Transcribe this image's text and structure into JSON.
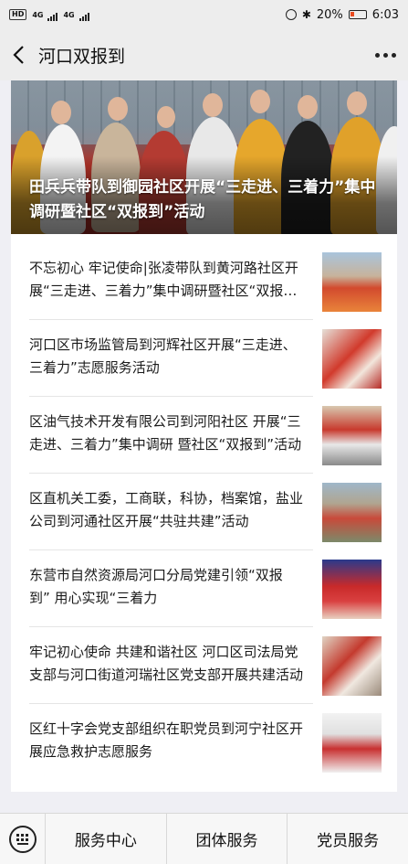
{
  "status_bar": {
    "hd": "HD",
    "net1": "4G",
    "net2": "4G",
    "battery_percent": "20%",
    "time": "6:03"
  },
  "header": {
    "title": "河口双报到"
  },
  "hero": {
    "title": "田兵兵带队到御园社区开展“三走进、三着力”集中调研暨社区“双报到”活动"
  },
  "articles": [
    {
      "title": "不忘初心 牢记使命|张凌带队到黄河路社区开展“三走进、三着力”集中调研暨社区“双报到”活动"
    },
    {
      "title": "河口区市场监管局到河辉社区开展“三走进、三着力”志愿服务活动"
    },
    {
      "title": "区油气技术开发有限公司到河阳社区 开展“三走进、三着力”集中调研 暨社区“双报到”活动"
    },
    {
      "title": "区直机关工委，工商联，科协，档案馆，盐业公司到河通社区开展“共驻共建”活动"
    },
    {
      "title": "东营市自然资源局河口分局党建引领“双报到” 用心实现“三着力"
    },
    {
      "title": "牢记初心使命 共建和谐社区 河口区司法局党支部与河口街道河瑞社区党支部开展共建活动"
    },
    {
      "title": "区红十字会党支部组织在职党员到河宁社区开展应急救护志愿服务"
    }
  ],
  "bottom_menu": {
    "items": [
      "服务中心",
      "团体服务",
      "党员服务"
    ]
  },
  "colors": {
    "accent_red": "#c8281e",
    "battery_low": "#e94a1f"
  }
}
